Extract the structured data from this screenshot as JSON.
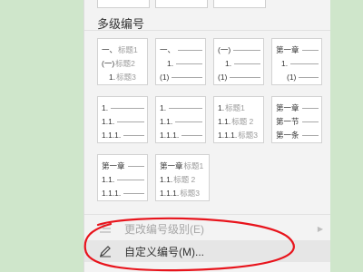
{
  "section": {
    "title": "多级编号"
  },
  "tiles": [
    {
      "lines": [
        {
          "prefix": "一、",
          "label": "标题1"
        },
        {
          "prefix": "(一)",
          "label": "标题2"
        },
        {
          "prefix": "1.",
          "label": "标题3"
        }
      ]
    },
    {
      "lines": [
        {
          "prefix": "一、",
          "label": ""
        },
        {
          "prefix": "1.",
          "label": ""
        },
        {
          "prefix": "(1)",
          "label": ""
        }
      ]
    },
    {
      "lines": [
        {
          "prefix": "(一)",
          "label": ""
        },
        {
          "prefix": "1.",
          "label": ""
        },
        {
          "prefix": "(1)",
          "label": ""
        }
      ]
    },
    {
      "lines": [
        {
          "prefix": "第一章",
          "label": ""
        },
        {
          "prefix": "1.",
          "label": ""
        },
        {
          "prefix": "(1)",
          "label": ""
        }
      ]
    },
    {
      "lines": [
        {
          "prefix": "1.",
          "label": ""
        },
        {
          "prefix": "1.1.",
          "label": ""
        },
        {
          "prefix": "1.1.1.",
          "label": ""
        }
      ]
    },
    {
      "lines": [
        {
          "prefix": "1.",
          "label": ""
        },
        {
          "prefix": "1.1.",
          "label": ""
        },
        {
          "prefix": "1.1.1.",
          "label": ""
        }
      ]
    },
    {
      "lines": [
        {
          "prefix": "1.",
          "label": "标题1"
        },
        {
          "prefix": "1.1.",
          "label": "标题 2"
        },
        {
          "prefix": "1.1.1.",
          "label": "标题3"
        }
      ]
    },
    {
      "lines": [
        {
          "prefix": "第一章",
          "label": ""
        },
        {
          "prefix": "第一节",
          "label": ""
        },
        {
          "prefix": "第一条",
          "label": ""
        }
      ]
    },
    {
      "lines": [
        {
          "prefix": "第一章",
          "label": ""
        },
        {
          "prefix": "1.1.",
          "label": ""
        },
        {
          "prefix": "1.1.1.",
          "label": ""
        }
      ]
    },
    {
      "lines": [
        {
          "prefix": "第一章",
          "label": "标题1"
        },
        {
          "prefix": "1.1.",
          "label": "标题 2"
        },
        {
          "prefix": "1.1.1.",
          "label": "标题3"
        }
      ]
    }
  ],
  "menu": {
    "change_level": {
      "label": "更改编号级别(E)",
      "enabled": false,
      "icon": "list-level-icon"
    },
    "custom_numbering": {
      "label": "自定义编号(M)...",
      "icon": "pencil-icon"
    }
  },
  "annotation": {
    "color": "#e8141c"
  }
}
